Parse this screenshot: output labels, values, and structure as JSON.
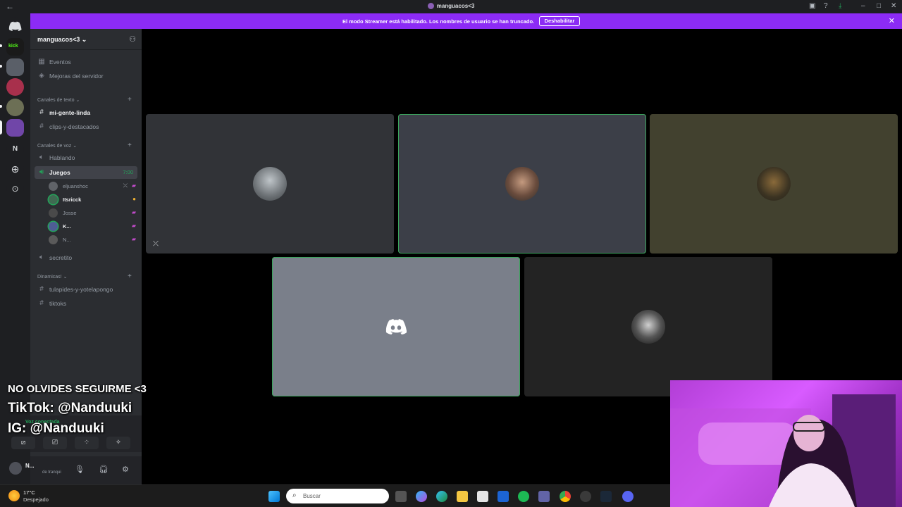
{
  "window": {
    "title": "manguacos<3",
    "back_icon": "←"
  },
  "banner": {
    "text": "El modo Streamer está habilitado. Los nombres de usuario se han truncado.",
    "button": "Deshabilitar"
  },
  "server": {
    "name": "manguacos<3 ⌄",
    "items": [
      {
        "icon": "calendar-icon",
        "label": "Eventos"
      },
      {
        "icon": "boost-icon",
        "label": "Mejoras del servidor"
      }
    ],
    "categories": {
      "text": "Canales de texto ⌄",
      "voice": "Canales de voz ⌄",
      "dynamic": "Dinamicas! ⌄"
    },
    "text_channels": [
      "mi-gente-linda",
      "clips-y-destacados"
    ],
    "voice_channels": {
      "hablando": "Hablando",
      "juegos": "Juegos",
      "juegos_time": "7:00",
      "secretito": "secretito"
    },
    "voice_users": [
      "eljuanshoc",
      "Itsricck",
      "Josse",
      "K...",
      "N..."
    ],
    "dynamic_channels": [
      "tulapides-y-yotelapongo",
      "tiktoks"
    ],
    "rail_letter": "N"
  },
  "user": {
    "name": "N...",
    "status": "de tranqui",
    "voice_status": "Voz conectada"
  },
  "overlay": {
    "line1": "NO OLVIDES SEGUIRME <3",
    "line2": "TikTok: @Nanduuki",
    "line3": "IG: @Nanduuki"
  },
  "taskbar": {
    "temp": "17°C",
    "weather": "Despejado",
    "search_placeholder": "Buscar"
  },
  "colors": {
    "banner": "#8c2bf5",
    "speaking": "#3ba55d",
    "sidebar": "#2b2d31"
  }
}
